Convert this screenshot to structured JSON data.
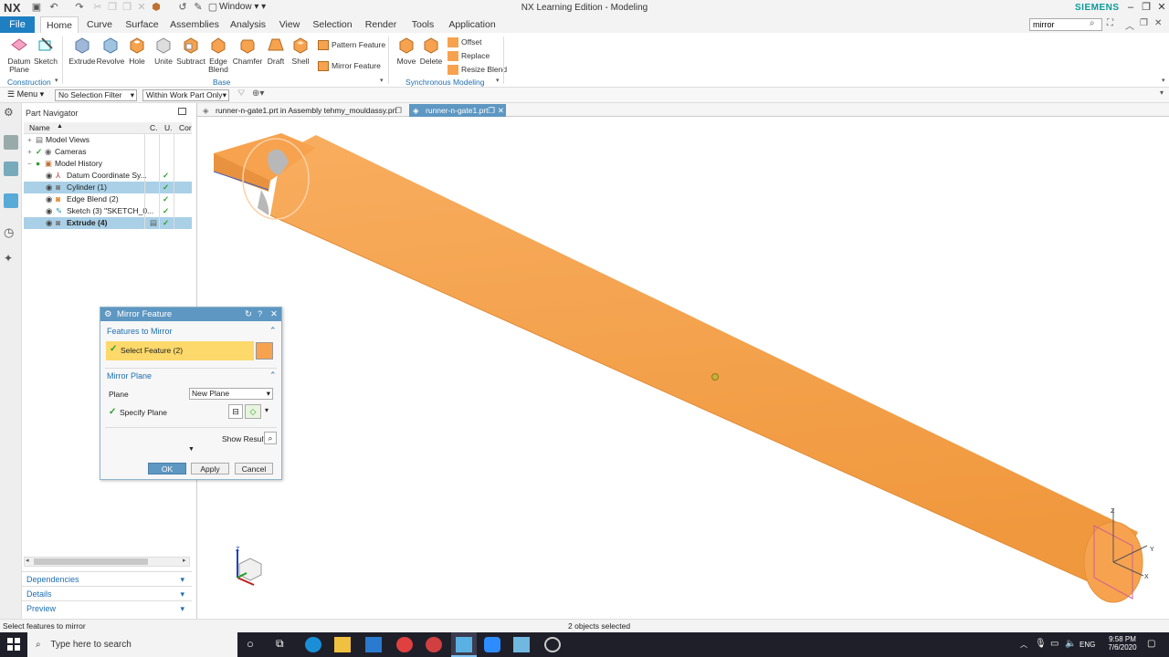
{
  "app": {
    "logo": "NX",
    "window_menu": "Window",
    "title": "NX Learning Edition - Modeling",
    "brand": "SIEMENS",
    "search_value": "mirror"
  },
  "ribbon_tabs": [
    "File",
    "Home",
    "Curve",
    "Surface",
    "Assemblies",
    "Analysis",
    "View",
    "Selection",
    "Render",
    "Tools",
    "Application"
  ],
  "ribbon": {
    "datum_plane": "Datum\nPlane",
    "sketch": "Sketch",
    "extrude": "Extrude",
    "revolve": "Revolve",
    "hole": "Hole",
    "unite": "Unite",
    "subtract": "Subtract",
    "edge_blend": "Edge\nBlend",
    "chamfer": "Chamfer",
    "draft": "Draft",
    "shell": "Shell",
    "pattern_feature": "Pattern Feature",
    "mirror_feature": "Mirror Feature",
    "move": "Move",
    "delete": "Delete",
    "offset": "Offset",
    "replace": "Replace",
    "resize_blend": "Resize Blend",
    "group_construction": "Construction",
    "group_base": "Base",
    "group_sync": "Synchronous Modeling"
  },
  "selection_bar": {
    "menu": "Menu",
    "filter": "No Selection Filter",
    "scope": "Within Work Part Only"
  },
  "part_navigator": {
    "title": "Part Navigator",
    "col_name": "Name",
    "col_c": "C.",
    "col_u": "U.",
    "col_com": "Cor",
    "rows": [
      {
        "label": "Model Views"
      },
      {
        "label": "Cameras"
      },
      {
        "label": "Model History"
      },
      {
        "label": "Datum Coordinate Sy..."
      },
      {
        "label": "Cylinder (1)"
      },
      {
        "label": "Edge Blend (2)"
      },
      {
        "label": "Sketch (3) \"SKETCH_0..."
      },
      {
        "label": "Extrude (4)"
      }
    ],
    "dependencies": "Dependencies",
    "details": "Details",
    "preview": "Preview"
  },
  "graphics_tabs": [
    {
      "label": "runner-n-gate1.prt in Assembly tehmy_mouldassy.prt"
    },
    {
      "label": "runner-n-gate1.prt"
    }
  ],
  "mirror_dialog": {
    "title": "Mirror Feature",
    "section_features": "Features to Mirror",
    "select_feature": "Select Feature (2)",
    "section_plane": "Mirror Plane",
    "plane_label": "Plane",
    "plane_value": "New Plane",
    "specify_plane": "Specify Plane",
    "show_result": "Show Result",
    "ok": "OK",
    "apply": "Apply",
    "cancel": "Cancel"
  },
  "status": {
    "left": "Select features to mirror",
    "center": "2 objects selected"
  },
  "taskbar": {
    "search": "Type here to search",
    "lang": "ENG",
    "time": "9:58 PM",
    "date": "7/6/2020"
  },
  "colors": {
    "accent": "#1e7fc2",
    "part_orange": "#f7a24f",
    "selection_yellow": "#fcd96a",
    "dialog_title": "#5d97c2"
  }
}
